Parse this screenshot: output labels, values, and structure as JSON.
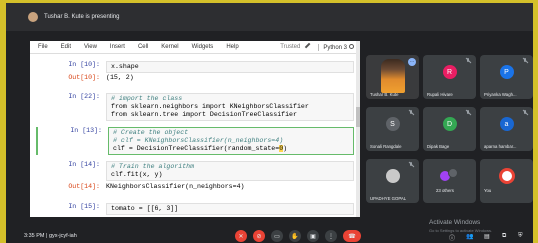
{
  "presenter": {
    "text": "Tushar B. Kute is presenting"
  },
  "jupyter": {
    "menu": [
      "File",
      "Edit",
      "View",
      "Insert",
      "Cell",
      "Kernel",
      "Widgets",
      "Help"
    ],
    "trusted": "Trusted",
    "kernel": "Python 3"
  },
  "cells": [
    {
      "prompt": "In [10]:",
      "code": "x.shape"
    },
    {
      "prompt": "Out[10]:",
      "output": "(15, 2)"
    },
    {
      "prompt": "In [22]:",
      "comment": "# import the class",
      "line2": "from sklearn.neighbors import KNeighborsClassifier",
      "line3": "from sklearn.tree import DecisionTreeClassifier"
    },
    {
      "prompt": "In [13]:",
      "comment": "# Create the object",
      "comment2": "# clf = KNeighborsClassifier(n_neighbors=4)",
      "line3a": "clf = DecisionTreeClassifier(random_state=",
      "cursor": "0",
      "line3b": ")"
    },
    {
      "prompt": "In [14]:",
      "comment": "# Train the algorithm",
      "line2": "clf.fit(x, y)"
    },
    {
      "prompt": "Out[14]:",
      "output": "KNeighborsClassifier(n_neighbors=4)"
    },
    {
      "prompt": "In [15]:",
      "code": "tomato = [[6, 3]]"
    }
  ],
  "participants": [
    {
      "name": "Tushar B. Kute"
    },
    {
      "name": "Rupali Hivare",
      "initial": "R",
      "color": "#e91e63"
    },
    {
      "name": "Priyanka Wagh...",
      "initial": "P",
      "color": "#1a73e8"
    },
    {
      "name": "Sonali Rangdale",
      "initial": "S",
      "color": "#5f6368"
    },
    {
      "name": "Dipak Bage",
      "initial": "D",
      "color": "#34a853"
    },
    {
      "name": "aparna hambar...",
      "initial": "a",
      "color": "#1967d2"
    },
    {
      "name": "UPADHYE GOPAL"
    },
    {
      "name": "23 others"
    },
    {
      "name": "You"
    }
  ],
  "bottom": {
    "time": "3:35 PM",
    "separator": "|",
    "meeting_code": "gyx-jcyf-iah"
  },
  "windows": {
    "activate": "Activate Windows",
    "sub": "Go to Settings to activate Windows."
  }
}
